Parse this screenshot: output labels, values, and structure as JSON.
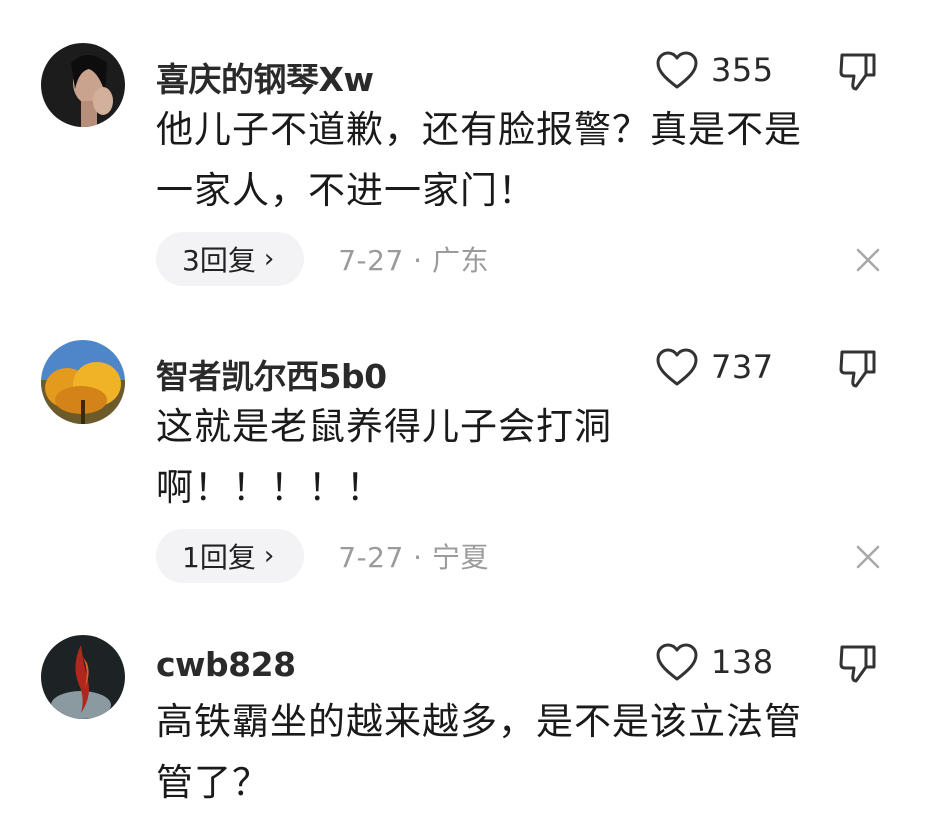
{
  "comments": [
    {
      "username": "喜庆的钢琴Xw",
      "likes": "355",
      "text_lines": [
        "他儿子不道歉，还有脸报警？真是不是",
        "一家人，不进一家门！"
      ],
      "replies": "3回复",
      "reply_chevron": "›",
      "date_location": "7-27 · 广东",
      "avatar_icon": "woman-portrait-avatar"
    },
    {
      "username": "智者凯尔西5b0",
      "likes": "737",
      "text_lines": [
        "这就是老鼠养得儿子会打洞",
        "啊！！！！！"
      ],
      "replies": "1回复",
      "reply_chevron": "›",
      "date_location": "7-27 · 宁夏",
      "avatar_icon": "autumn-tree-avatar"
    },
    {
      "username": "cwb828",
      "likes": "138",
      "text_lines": [
        "高铁霸坐的越来越多，是不是该立法管",
        "管了？"
      ],
      "avatar_icon": "dark-flame-avatar"
    }
  ],
  "icons": {
    "like": "heart-outline-icon",
    "dislike": "thumbs-down-icon",
    "close": "close-x-icon"
  },
  "colors": {
    "text_primary": "#1a1a1a",
    "meta_gray": "#9b9b9b",
    "pill_bg": "#f3f3f5",
    "icon_gray": "#333333"
  }
}
